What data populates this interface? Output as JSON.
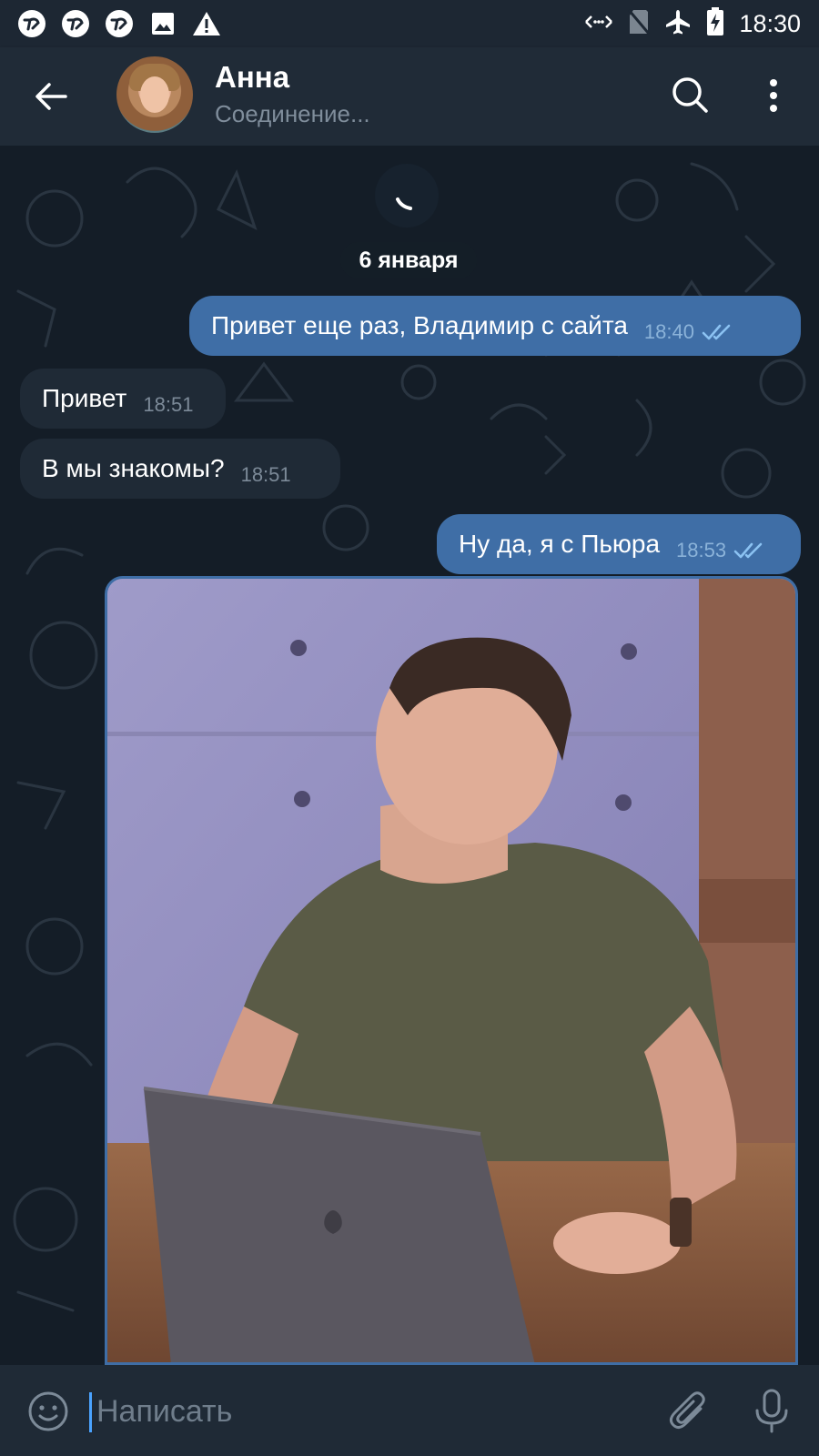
{
  "status_bar": {
    "time": "18:30",
    "left_icons": [
      "app-notification-icon",
      "app-notification-icon",
      "app-notification-icon",
      "image-icon",
      "warning-icon"
    ],
    "right_icons": [
      "data-arrows-icon",
      "no-sim-icon",
      "airplane-icon",
      "battery-charging-icon"
    ]
  },
  "header": {
    "contact_name": "Анна",
    "connection_status": "Соединение..."
  },
  "chat": {
    "date_separator": "6 января",
    "messages": [
      {
        "direction": "out",
        "text": "Привет еще раз, Владимир с сайта",
        "time": "18:40",
        "read": true
      },
      {
        "direction": "in",
        "text": "Привет",
        "time": "18:51"
      },
      {
        "direction": "in",
        "text": "В мы знакомы?",
        "time": "18:51"
      },
      {
        "direction": "out",
        "text": "Ну да, я с Пьюра",
        "time": "18:53",
        "read": true
      }
    ],
    "photo_message": {
      "direction": "out",
      "type": "photo"
    }
  },
  "composer": {
    "placeholder": "Написать"
  },
  "colors": {
    "outgoing_bubble": "#3f6ea6",
    "incoming_bubble": "#1f2a36",
    "header_bg": "#202b37",
    "chat_bg": "#141d27",
    "accent": "#4aa3ff"
  }
}
